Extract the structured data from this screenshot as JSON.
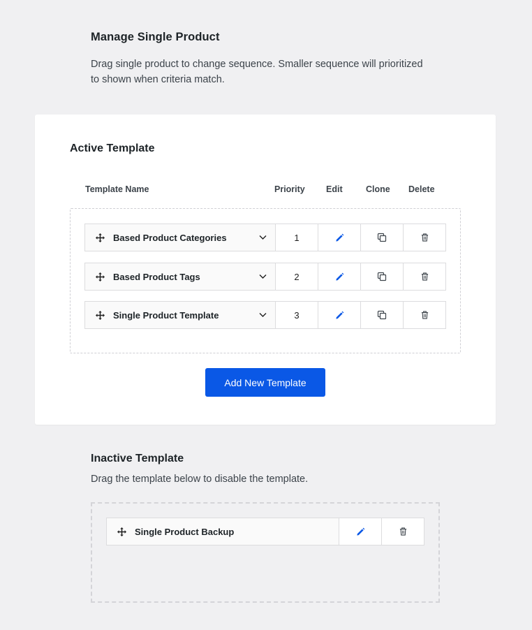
{
  "intro": {
    "title": "Manage Single Product",
    "description": "Drag single product to change sequence. Smaller sequence will prioritized to shown when criteria match."
  },
  "active": {
    "title": "Active Template",
    "columns": {
      "name": "Template Name",
      "priority": "Priority",
      "edit": "Edit",
      "clone": "Clone",
      "delete": "Delete"
    },
    "rows": [
      {
        "name": "Based Product Categories",
        "priority": "1"
      },
      {
        "name": "Based Product Tags",
        "priority": "2"
      },
      {
        "name": "Single Product Template",
        "priority": "3"
      }
    ],
    "add_button": "Add New Template"
  },
  "inactive": {
    "title": "Inactive Template",
    "description": "Drag the template below to disable the template.",
    "rows": [
      {
        "name": "Single Product Backup"
      }
    ]
  },
  "colors": {
    "accent": "#0a58e6",
    "background": "#f0f0f2",
    "border": "#dcdcde"
  },
  "icons": {
    "drag": "move-arrows-icon",
    "edit": "pencil-icon",
    "clone": "copy-icon",
    "delete": "trash-icon",
    "expand": "chevron-down-icon"
  }
}
